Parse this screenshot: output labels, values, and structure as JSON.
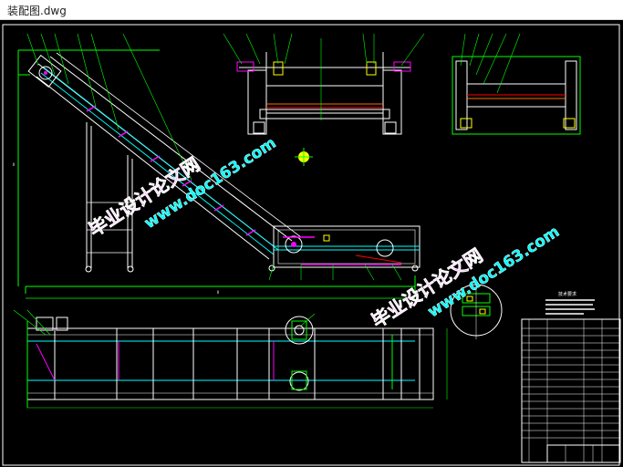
{
  "window": {
    "title": "装配图.dwg"
  },
  "drawing": {
    "background": "#000000",
    "colors": {
      "white": "#ffffff",
      "green": "#00ff00",
      "cyan": "#00ffff",
      "magenta": "#ff00ff",
      "red": "#ff0000",
      "yellow": "#ffff00",
      "orange": "#ff6a00"
    },
    "watermarks": {
      "cn_text": "毕业设计论文网",
      "url_text": "www.doc163.com"
    },
    "title_block": {
      "header": "技术要求"
    },
    "icon": "compass-symbol-icon"
  }
}
